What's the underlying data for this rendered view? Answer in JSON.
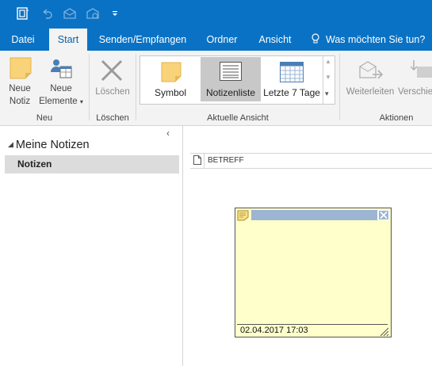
{
  "tabs": {
    "file": "Datei",
    "start": "Start",
    "send_receive": "Senden/Empfangen",
    "folder": "Ordner",
    "view": "Ansicht",
    "tell_me": "Was möchten Sie tun?"
  },
  "ribbon": {
    "new_note_line1": "Neue",
    "new_note_line2": "Notiz",
    "new_items_line1": "Neue",
    "new_items_line2": "Elemente",
    "group_new": "Neu",
    "delete": "Löschen",
    "group_delete": "Löschen",
    "view_symbol": "Symbol",
    "view_notes_list": "Notizenliste",
    "view_last7": "Letzte 7 Tage",
    "group_current_view": "Aktuelle Ansicht",
    "forward": "Weiterleiten",
    "move": "Verschie",
    "group_actions": "Aktionen"
  },
  "nav": {
    "section_title": "Meine Notizen",
    "folder_notes": "Notizen"
  },
  "list": {
    "column_subject": "BETREFF"
  },
  "note": {
    "timestamp": "02.04.2017 17:03"
  },
  "colors": {
    "accent": "#0a72c4",
    "note_bg": "#ffffcc",
    "note_header": "#9db4d2"
  }
}
